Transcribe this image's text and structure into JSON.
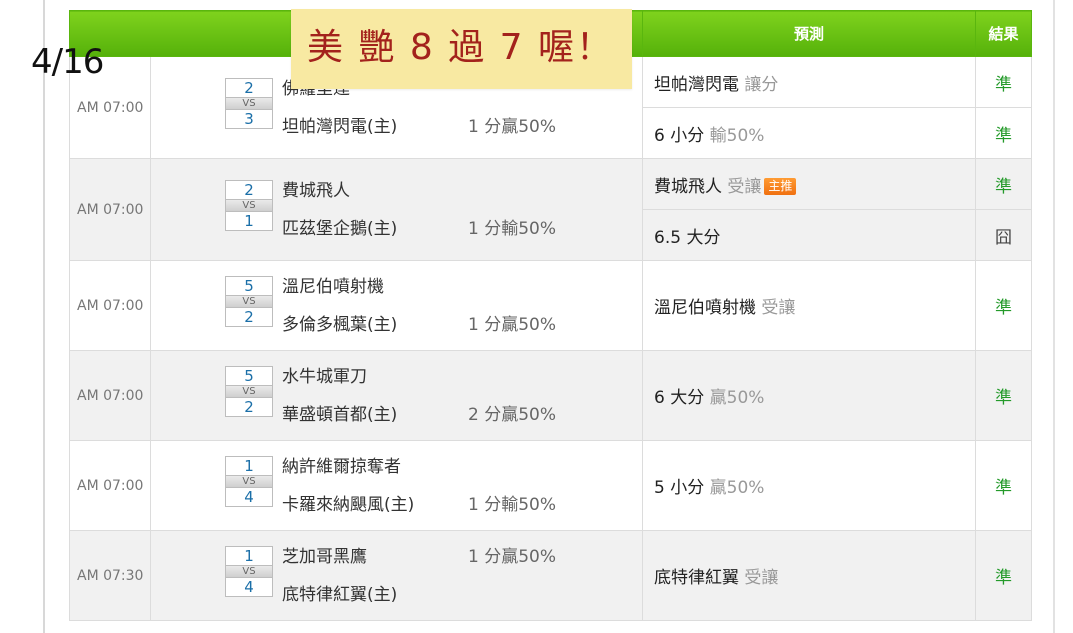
{
  "date": "4/16",
  "banner": "美 艷 8 過 7 喔！",
  "header": {
    "game": "",
    "prediction": "預測",
    "result": "結果"
  },
  "games": [
    {
      "time": "AM 07:00",
      "away_score": "2",
      "home_score": "3",
      "vs": "VS",
      "away_team": "佛羅里達",
      "home_team": "坦帕灣閃電(主)",
      "handicap": "1 分贏50%",
      "handicap_row": "home",
      "predictions": [
        {
          "pick": "坦帕灣閃電",
          "note": "讓分",
          "tag": "",
          "result": "準"
        },
        {
          "pick": "6 小分",
          "note": "輸50%",
          "tag": "",
          "result": "準"
        }
      ]
    },
    {
      "time": "AM 07:00",
      "away_score": "2",
      "home_score": "1",
      "vs": "VS",
      "away_team": "費城飛人",
      "home_team": "匹茲堡企鵝(主)",
      "handicap": "1 分輸50%",
      "handicap_row": "home",
      "predictions": [
        {
          "pick": "費城飛人",
          "note": "受讓",
          "tag": "主推",
          "result": "準"
        },
        {
          "pick": "6.5 大分",
          "note": "",
          "tag": "",
          "result": "囧"
        }
      ]
    },
    {
      "time": "AM 07:00",
      "away_score": "5",
      "home_score": "2",
      "vs": "VS",
      "away_team": "溫尼伯噴射機",
      "home_team": "多倫多楓葉(主)",
      "handicap": "1 分贏50%",
      "handicap_row": "home",
      "predictions": [
        {
          "pick": "溫尼伯噴射機",
          "note": "受讓",
          "tag": "",
          "result": "準"
        }
      ]
    },
    {
      "time": "AM 07:00",
      "away_score": "5",
      "home_score": "2",
      "vs": "VS",
      "away_team": "水牛城軍刀",
      "home_team": "華盛頓首都(主)",
      "handicap": "2 分贏50%",
      "handicap_row": "home",
      "predictions": [
        {
          "pick": "6 大分",
          "note": "贏50%",
          "tag": "",
          "result": "準"
        }
      ]
    },
    {
      "time": "AM 07:00",
      "away_score": "1",
      "home_score": "4",
      "vs": "VS",
      "away_team": "納許維爾掠奪者",
      "home_team": "卡羅來納颶風(主)",
      "handicap": "1 分輸50%",
      "handicap_row": "home",
      "predictions": [
        {
          "pick": "5 小分",
          "note": "贏50%",
          "tag": "",
          "result": "準"
        }
      ]
    },
    {
      "time": "AM 07:30",
      "away_score": "1",
      "home_score": "4",
      "vs": "VS",
      "away_team": "芝加哥黑鷹",
      "home_team": "底特律紅翼(主)",
      "handicap": "1 分贏50%",
      "handicap_row": "away",
      "predictions": [
        {
          "pick": "底特律紅翼",
          "note": "受讓",
          "tag": "",
          "result": "準"
        }
      ]
    }
  ]
}
